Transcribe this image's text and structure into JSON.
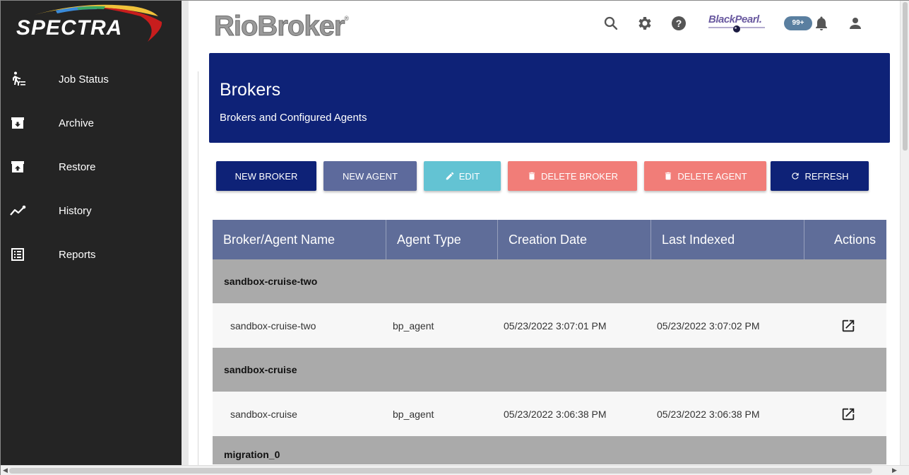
{
  "sidebar": {
    "logo_text": "SPECTRA",
    "items": [
      {
        "label": "Job Status",
        "icon": "job-status-icon"
      },
      {
        "label": "Archive",
        "icon": "archive-icon"
      },
      {
        "label": "Restore",
        "icon": "restore-icon"
      },
      {
        "label": "History",
        "icon": "history-icon"
      },
      {
        "label": "Reports",
        "icon": "reports-icon"
      }
    ]
  },
  "topbar": {
    "brand": "RioBroker",
    "brand_mark": "®",
    "blackpearl": "BlackPearl.",
    "notification_count": "99+"
  },
  "header": {
    "title": "Brokers",
    "subtitle": "Brokers and Configured Agents"
  },
  "toolbar": {
    "new_broker": "NEW BROKER",
    "new_agent": "NEW AGENT",
    "edit": "EDIT",
    "delete_broker": "DELETE BROKER",
    "delete_agent": "DELETE AGENT",
    "refresh": "REFRESH"
  },
  "table": {
    "columns": [
      "Broker/Agent Name",
      "Agent Type",
      "Creation Date",
      "Last Indexed",
      "Actions"
    ],
    "groups": [
      {
        "broker": "sandbox-cruise-two",
        "agents": [
          {
            "name": "sandbox-cruise-two",
            "type": "bp_agent",
            "created": "05/23/2022 3:07:01 PM",
            "indexed": "05/23/2022 3:07:02 PM"
          }
        ]
      },
      {
        "broker": "sandbox-cruise",
        "agents": [
          {
            "name": "sandbox-cruise",
            "type": "bp_agent",
            "created": "05/23/2022 3:06:38 PM",
            "indexed": "05/23/2022 3:06:38 PM"
          }
        ]
      },
      {
        "broker": "migration_0",
        "agents": []
      }
    ]
  },
  "colors": {
    "sidebar_bg": "#242424",
    "primary": "#0e2277",
    "secondary": "#5d6a9c",
    "edit": "#63c3d3",
    "danger": "#f17d78",
    "table_header": "#5f6d99",
    "group_row": "#aaaaaa"
  }
}
